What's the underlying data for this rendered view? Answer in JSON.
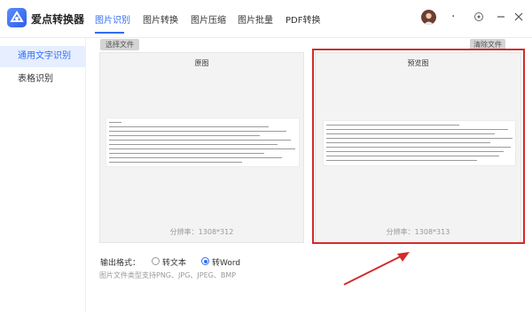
{
  "app": {
    "title": "爱点转换器"
  },
  "tabs": [
    {
      "label": "图片识别",
      "active": true
    },
    {
      "label": "图片转换",
      "active": false
    },
    {
      "label": "图片压缩",
      "active": false
    },
    {
      "label": "图片批量",
      "active": false
    },
    {
      "label": "PDF转换",
      "active": false
    }
  ],
  "window_controls": {
    "dot": "."
  },
  "sidebar": {
    "items": [
      {
        "label": "通用文字识别",
        "active": true
      },
      {
        "label": "表格识别",
        "active": false
      }
    ]
  },
  "toolbar": {
    "choose_file": "选择文件",
    "clear_file": "清除文件"
  },
  "original_panel": {
    "title": "原图",
    "resolution": "分辨率：1308*312"
  },
  "preview_panel": {
    "title": "预览图",
    "resolution": "分辨率：1308*313"
  },
  "output_format": {
    "label": "输出格式：",
    "options": [
      {
        "label": "转文本",
        "checked": false
      },
      {
        "label": "转Word",
        "checked": true
      }
    ]
  },
  "supported_types": "图片文件类型支持PNG、JPG、JPEG、BMP",
  "colors": {
    "accent": "#2f6df5",
    "highlight": "#d42b2b",
    "arrow": "#d42b2b"
  },
  "icons": [
    "app-logo-icon",
    "avatar-icon",
    "settings-icon",
    "minimize-icon",
    "close-icon",
    "red-arrow-icon"
  ]
}
